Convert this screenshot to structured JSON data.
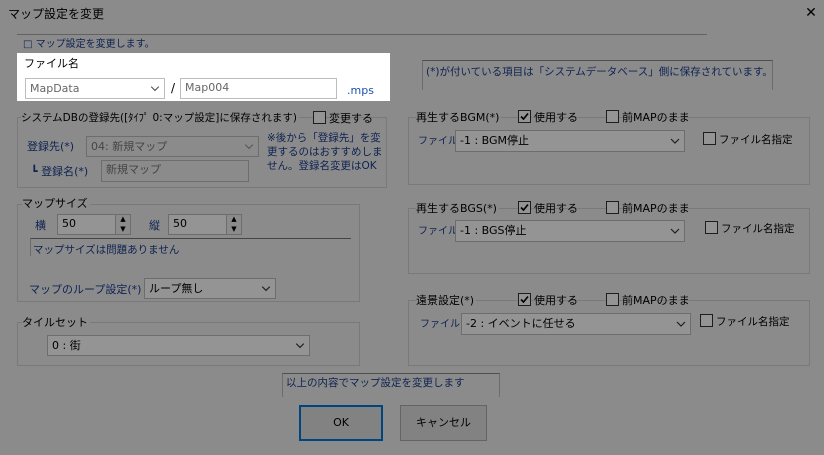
{
  "window": {
    "title": "マップ設定を変更",
    "close_glyph": "✕"
  },
  "header": {
    "notice": "□ マップ設定を変更します。"
  },
  "file_name": {
    "label": "ファイル名",
    "folder": "MapData",
    "separator": "/",
    "name": "Map004",
    "ext": ".mps"
  },
  "db_section": {
    "title": "システムDBの登録先([ﾀｲﾌﾟ 0:マップ設定]に保存されます)",
    "change_label": "変更する",
    "dest_label": "登録先(*)",
    "dest_value": "04: 新規マップ",
    "regname_label": "┗ 登録名(*)",
    "regname_value": "新規マップ",
    "note": "※後から「登録先」を変更するのはおすすめしません。登録名変更はOK"
  },
  "map_size": {
    "title": "マップサイズ",
    "width_label": "横",
    "width_value": "50",
    "height_label": "縦",
    "height_value": "50",
    "size_note": "マップサイズは問題ありません",
    "loop_label": "マップのループ設定(*)",
    "loop_value": "ループ無し"
  },
  "tileset": {
    "title": "タイルセット",
    "value": "0 : 街"
  },
  "info_note": "(*)が付いている項目は「システムデータベース」側に保存されています。",
  "bgm": {
    "title": "再生するBGM(*)",
    "use_label": "使用する",
    "keep_label": "前MAPのまま",
    "file_label": "ファイル",
    "file_value": "-1 : BGM停止",
    "filename_label": "ファイル名指定"
  },
  "bgs": {
    "title": "再生するBGS(*)",
    "use_label": "使用する",
    "keep_label": "前MAPのまま",
    "file_label": "ファイル",
    "file_value": "-1 : BGS停止",
    "filename_label": "ファイル名指定"
  },
  "background": {
    "title": "遠景設定(*)",
    "use_label": "使用する",
    "keep_label": "前MAPのまま",
    "file_label": "ファイル",
    "file_value": "-2 : イベントに任せる",
    "filename_label": "ファイル名指定"
  },
  "footer": {
    "message": "以上の内容でマップ設定を変更します",
    "ok_label": "OK",
    "cancel_label": "キャンセル"
  }
}
